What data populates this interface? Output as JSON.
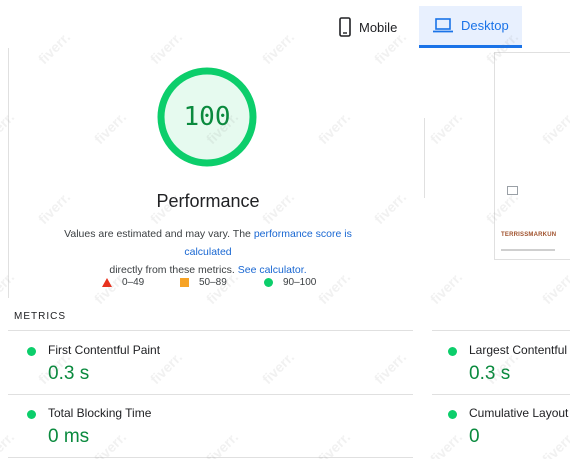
{
  "tabs": [
    {
      "label": "Mobile",
      "icon": "phone-icon",
      "selected": false
    },
    {
      "label": "Desktop",
      "icon": "laptop-icon",
      "selected": true
    }
  ],
  "performance": {
    "score": "100",
    "title": "Performance",
    "desc_text1": "Values are estimated and may vary. The ",
    "desc_link1": "performance score is calculated",
    "desc_text2": "directly from these metrics. ",
    "desc_link2": "See calculator."
  },
  "legend": [
    {
      "range": "0–49",
      "shape": "triangle",
      "color": "#e8321e"
    },
    {
      "range": "50–89",
      "shape": "square",
      "color": "#f7a325"
    },
    {
      "range": "90–100",
      "shape": "circle",
      "color": "#0cce6b"
    }
  ],
  "thumbnail": {
    "logo_text": "TERRISSMARKUN"
  },
  "metrics": {
    "heading": "METRICS",
    "items": [
      {
        "name": "First Contentful Paint",
        "value": "0.3 s"
      },
      {
        "name": "Largest Contentful",
        "value": "0.3 s"
      },
      {
        "name": "Total Blocking Time",
        "value": "0 ms"
      },
      {
        "name": "Cumulative Layout",
        "value": "0"
      }
    ]
  },
  "watermark": "fiverr.",
  "colors": {
    "pass": "#0cce6b",
    "pass_text": "#0a8a3e",
    "accent": "#1a73e8"
  }
}
